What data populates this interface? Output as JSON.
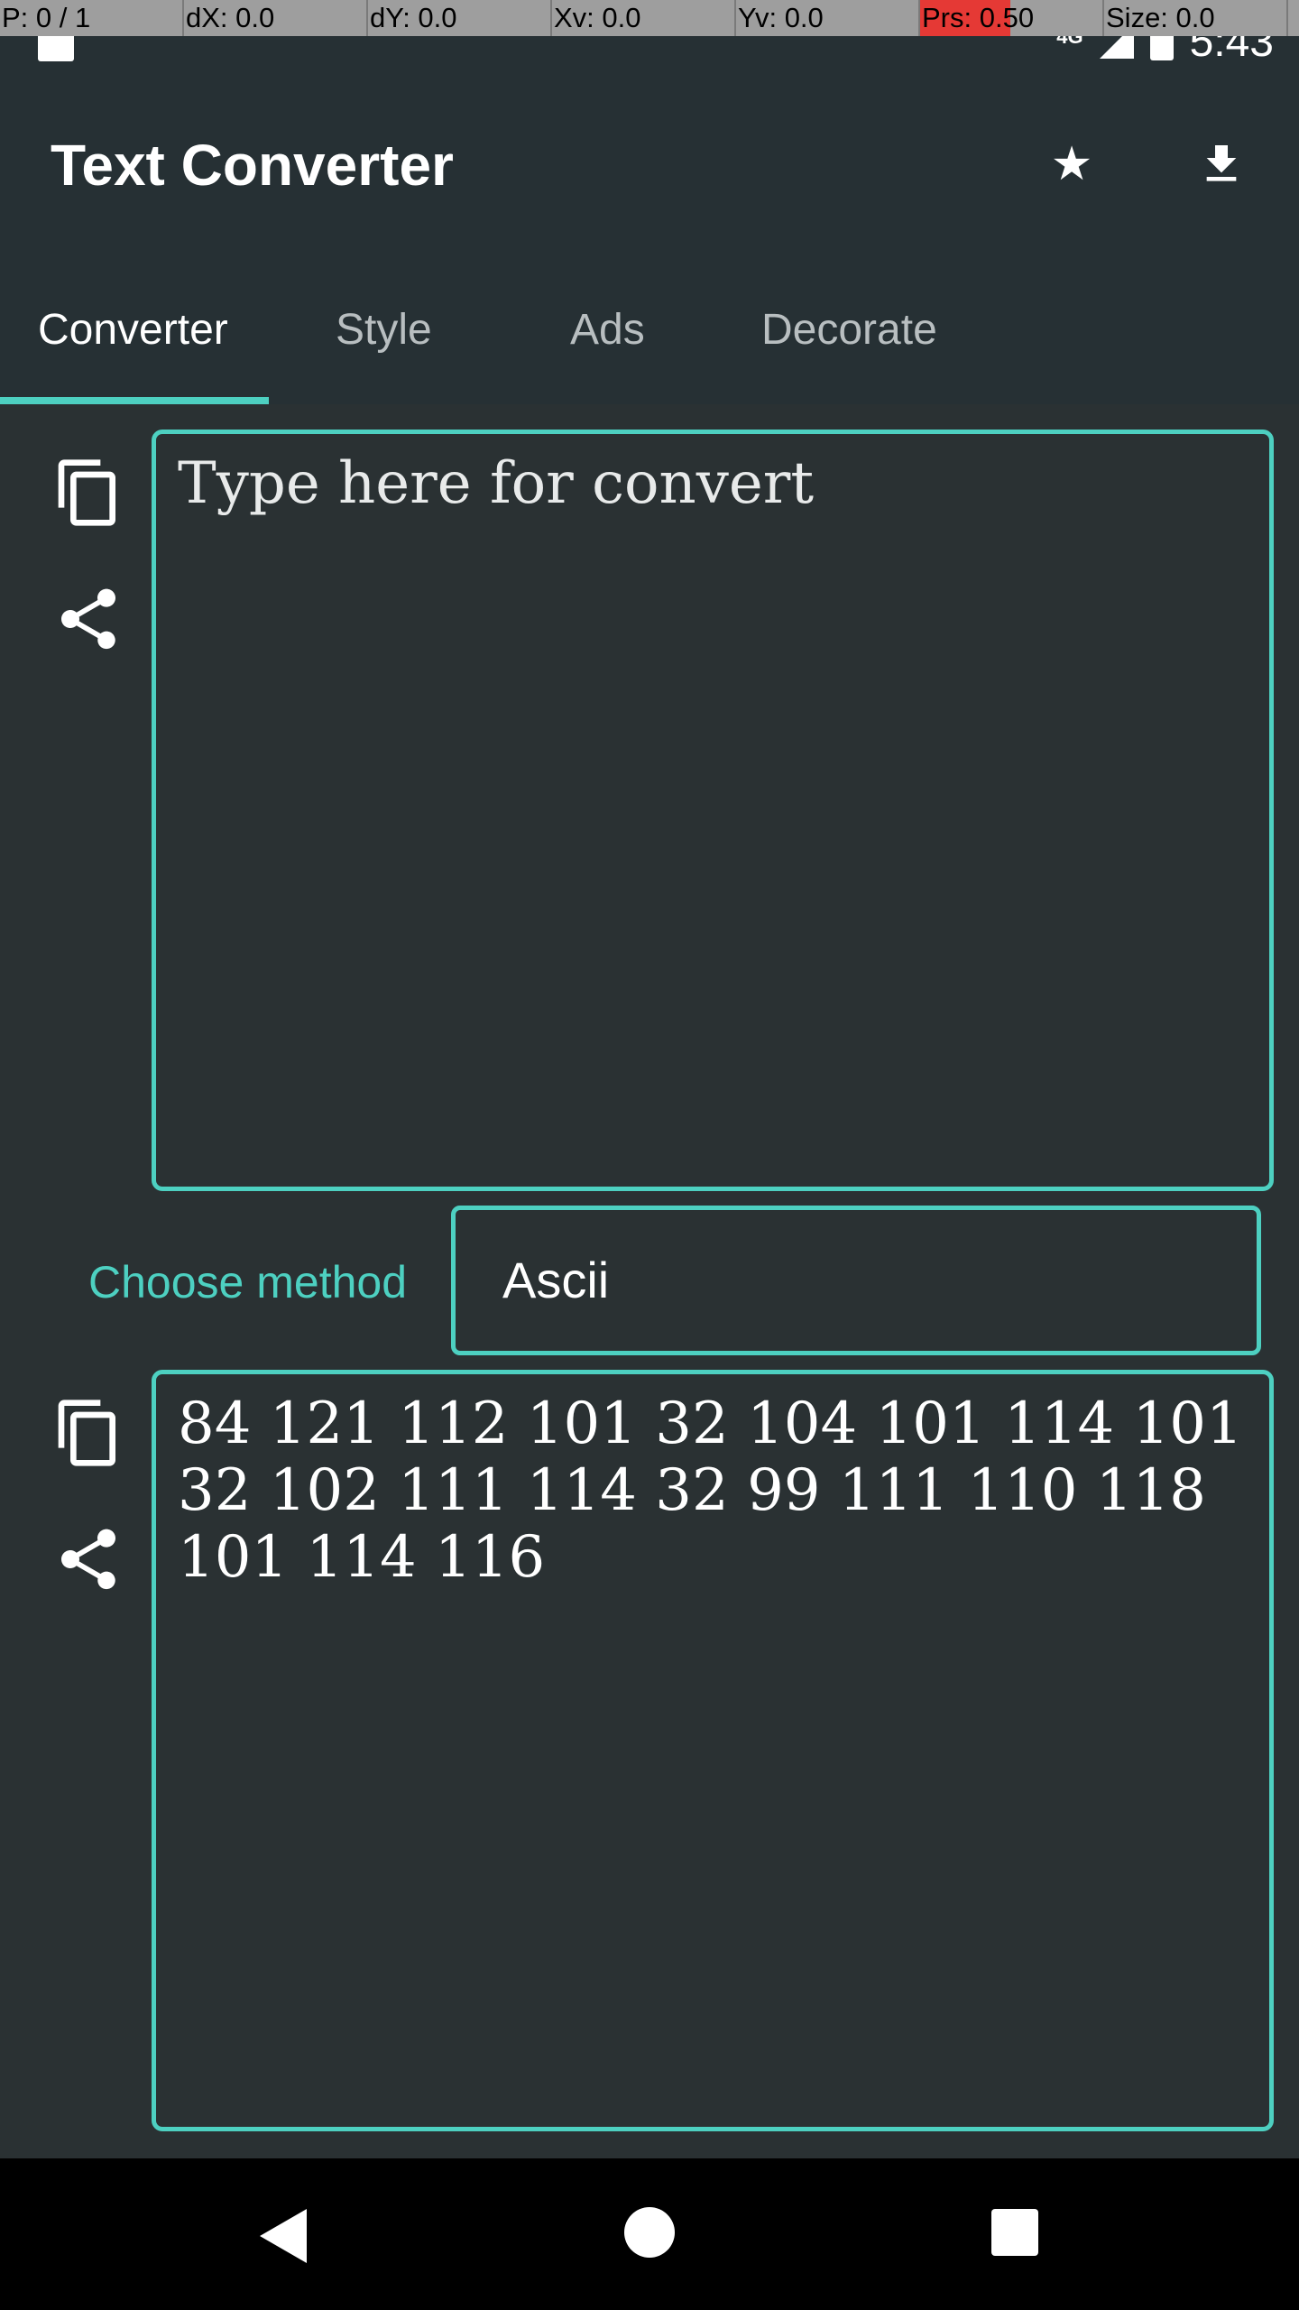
{
  "debug_bar": {
    "p": "P: 0 / 1",
    "dx": "dX: 0.0",
    "dy": "dY: 0.0",
    "xv": "Xv: 0.0",
    "yv": "Yv: 0.0",
    "prs": "Prs: 0.50",
    "size": "Size: 0.0"
  },
  "status_bar": {
    "network": "4G",
    "time": "5:43"
  },
  "app_bar": {
    "title": "Text Converter",
    "icons": [
      "star-icon",
      "download-icon"
    ]
  },
  "tabs": [
    {
      "label": "Converter",
      "active": true
    },
    {
      "label": "Style",
      "active": false
    },
    {
      "label": "Ads",
      "active": false
    },
    {
      "label": "Decorate",
      "active": false
    }
  ],
  "input": {
    "placeholder": "Type here for convert",
    "value": ""
  },
  "method": {
    "label": "Choose method",
    "selected": "Ascii"
  },
  "output": {
    "value": "84 121 112 101 32 104 101 114 101 32 102 111 114 32 99 111 110 118 101 114 116"
  },
  "colors": {
    "accent": "#4dd0c1",
    "background": "#2a3133",
    "toolbar": "#263034"
  }
}
